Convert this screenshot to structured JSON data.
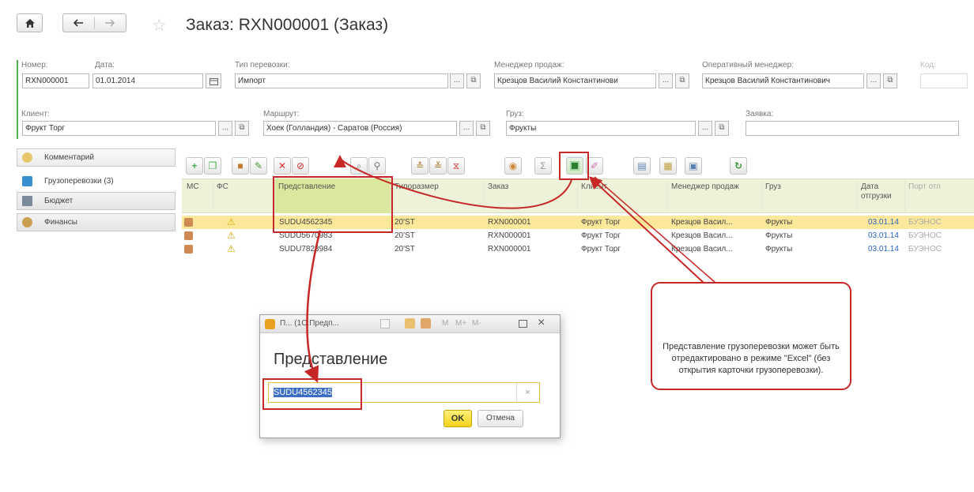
{
  "header": {
    "home_icon": "home-icon",
    "back_icon": "arrow-left-icon",
    "forward_icon": "arrow-right-icon",
    "star_icon": "star-icon",
    "title": "Заказ: RXN000001 (Заказ)"
  },
  "form": {
    "number": {
      "label": "Номер:",
      "value": "RXN000001"
    },
    "date": {
      "label": "Дата:",
      "value": "01.01.2014"
    },
    "transport_type": {
      "label": "Тип перевозки:",
      "value": "Импорт"
    },
    "sales_manager": {
      "label": "Менеджер продаж:",
      "value": "Крезцов Василий Константинови"
    },
    "ops_manager": {
      "label": "Оперативный менеджер:",
      "value": "Крезцов Василий Константинович"
    },
    "code": {
      "label": "Код:"
    },
    "client": {
      "label": "Клиент:",
      "value": "Фрукт Торг"
    },
    "route": {
      "label": "Маршрут:",
      "value": "Хоек (Голландия) - Саратов (Россия)"
    },
    "cargo": {
      "label": "Груз:",
      "value": "Фрукты"
    },
    "request": {
      "label": "Заявка:",
      "value": ""
    },
    "dots": "...",
    "link": "⧉"
  },
  "sidebar": {
    "items": [
      {
        "label": "Комментарий",
        "color": "#e6c86a"
      },
      {
        "label": "Грузоперевозки (3)",
        "color": "#3a8fd0"
      },
      {
        "label": "Бюджет",
        "color": "#7a8a9a"
      },
      {
        "label": "Финансы",
        "color": "#caa050"
      }
    ]
  },
  "table": {
    "headers": [
      "МС",
      "ФС",
      "Представление",
      "Типоразмер",
      "Заказ",
      "Клиент",
      "Менеджер продаж",
      "Груз",
      "Дата отгрузки",
      "Порт отп"
    ],
    "rows": [
      {
        "repr": "SUDU4562345",
        "size": "20'ST",
        "order": "RXN000001",
        "client": "Фрукт Торг",
        "manager": "Крезцов Васил...",
        "cargo": "Фрукты",
        "date": "03.01.14",
        "port": "БУЭНОС"
      },
      {
        "repr": "SUDU5670983",
        "size": "20'ST",
        "order": "RXN000001",
        "client": "Фрукт Торг",
        "manager": "Крезцов Васил...",
        "cargo": "Фрукты",
        "date": "03.01.14",
        "port": "БУЭНОС"
      },
      {
        "repr": "SUDU7823984",
        "size": "20'ST",
        "order": "RXN000001",
        "client": "Фрукт Торг",
        "manager": "Крезцов Васил...",
        "cargo": "Фрукты",
        "date": "03.01.14",
        "port": "БУЭНОС"
      }
    ]
  },
  "dialog": {
    "title": "П... (1С:Предп...",
    "heading": "Представление",
    "input_value": "SUDU4562345",
    "clear": "×",
    "ok": "OK",
    "cancel": "Отмена",
    "title_buttons": [
      "M",
      "M+",
      "M-"
    ],
    "close": "×"
  },
  "callout": {
    "text": "Представление грузоперевозки может быть отредактировано в режиме \"Excel\" (без открытия карточки грузоперевозки)."
  },
  "colors": {
    "accent_green": "#4caf50",
    "selected_row": "#fbe89a",
    "header_bg": "#eef2d8",
    "highlight": "#c62828",
    "link_blue": "#2a63c4"
  }
}
